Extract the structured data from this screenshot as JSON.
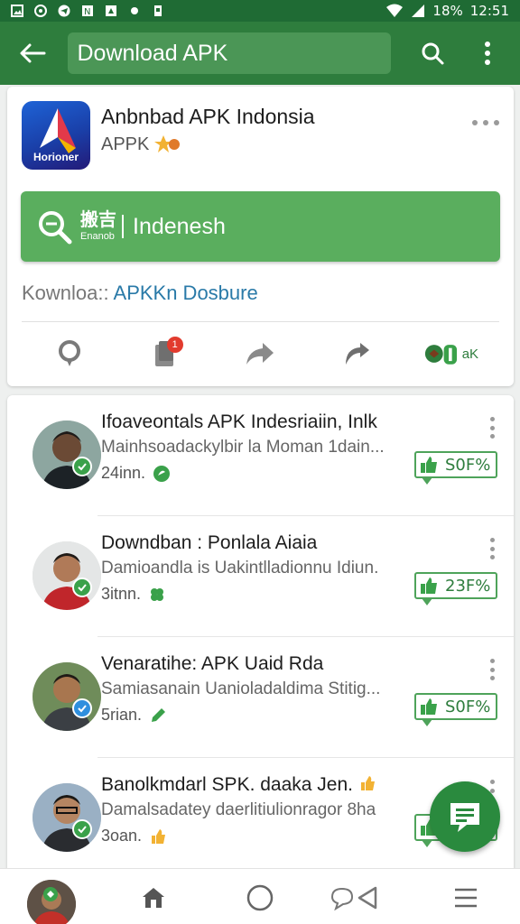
{
  "status_bar": {
    "battery": "18%",
    "time": "12:51"
  },
  "app_bar": {
    "title": "Download APK"
  },
  "app_card": {
    "icon_label": "Horioner",
    "title": "Anbnbad APK Indonsia",
    "subtitle": "APPK",
    "download_button": {
      "chinese_text": "搬吉",
      "small_text": "Enanob",
      "label": "Indenesh"
    },
    "download_line": {
      "prefix": "Kownloa:: ",
      "link": "APKKn Dosbure"
    },
    "actions": {
      "badge": "1",
      "apk_label": "aK"
    }
  },
  "list": [
    {
      "title": "Ifoaveontals APK Indesriaiin, Inlk",
      "subtitle": "Mainhsoadackylbir la Moman 1dain...",
      "meta": "24inn.",
      "percent": "S0F%",
      "verified": "green"
    },
    {
      "title": "Downdban : Ponlala Aiaia",
      "subtitle": "Damioandla is Uakintlladionnu Idiun.",
      "meta": "3itnn.",
      "percent": "23F%",
      "verified": "green"
    },
    {
      "title": "Venaratihe: APK Uaid Rda",
      "subtitle": "Samiasanain Uanioladaldima Stitig...",
      "meta": "5rian.",
      "percent": "S0F%",
      "verified": "blue"
    },
    {
      "title": "Banolkmdarl SPK. daaka Jen.",
      "subtitle": "Damalsadatey daerlitiulionragor 8ha",
      "meta": "3oan.",
      "percent": "",
      "verified": "green"
    }
  ],
  "colors": {
    "primary": "#2e7d3d",
    "status_bar": "#1f6b34",
    "button": "#5aae5e",
    "link": "#2a7aa8",
    "badge": "#e23b2e"
  },
  "icons": [
    "back-arrow-icon",
    "search-icon",
    "more-vert-icon",
    "location-pin-icon",
    "bookmark-icon",
    "share-icon",
    "forward-icon",
    "chat-fab-icon",
    "home-icon",
    "circle-icon",
    "back-triangle-icon",
    "menu-icon"
  ]
}
